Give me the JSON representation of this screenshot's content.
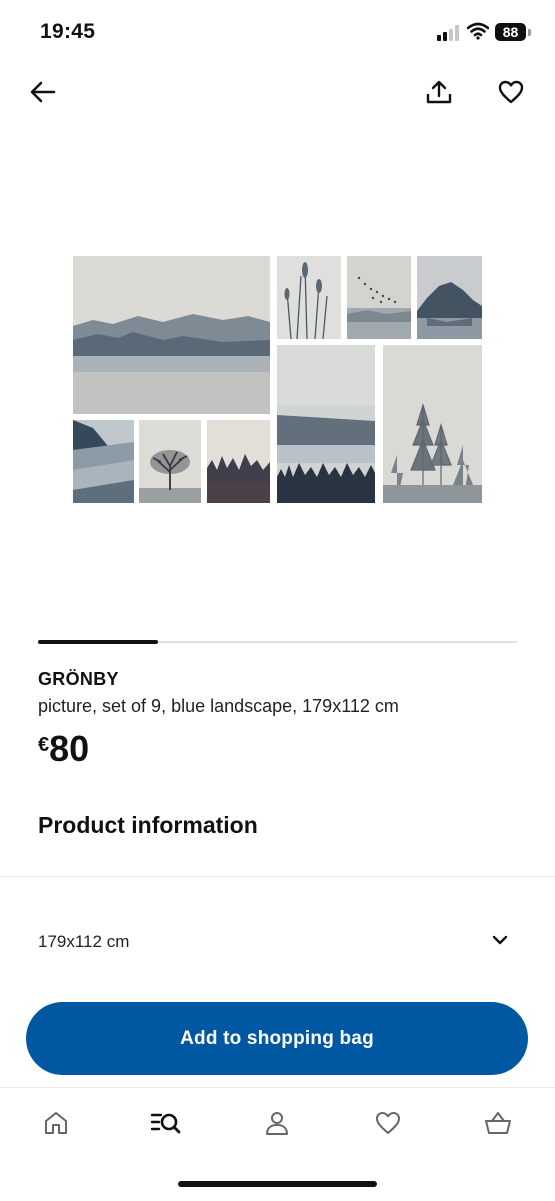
{
  "status_bar": {
    "time": "19:45",
    "battery": "88"
  },
  "header": {
    "back_icon": "arrow-left-icon",
    "share_icon": "share-icon",
    "favorite_icon": "heart-icon"
  },
  "gallery": {
    "image_count": 1,
    "current_index": 1,
    "progress_fraction": 0.25
  },
  "product": {
    "name": "GRÖNBY",
    "description": "picture, set of 9, blue landscape, 179x112 cm",
    "price_currency": "€",
    "price_value": "80"
  },
  "product_information": {
    "title": "Product information"
  },
  "size_selector": {
    "value": "179x112 cm",
    "icon": "chevron-down-icon"
  },
  "cta": {
    "label": "Add to shopping bag",
    "color": "#0058a3"
  },
  "tabbar": {
    "items": [
      {
        "icon": "home-icon"
      },
      {
        "icon": "search-list-icon"
      },
      {
        "icon": "profile-icon"
      },
      {
        "icon": "heart-icon"
      },
      {
        "icon": "basket-icon"
      }
    ]
  }
}
